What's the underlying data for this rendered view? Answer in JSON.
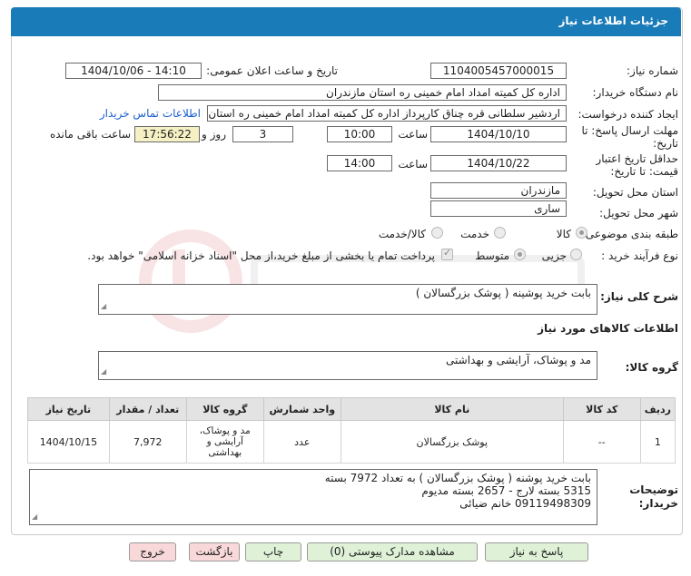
{
  "header": {
    "title": "جزئیات اطلاعات نیاز"
  },
  "fields": {
    "need_number_label": "شماره نیاز:",
    "need_number": "1104005457000015",
    "announce_label": "تاریخ و ساعت اعلان عمومی:",
    "announce_value": "1404/10/06 - 14:10",
    "buyer_org_label": "نام دستگاه خریدار:",
    "buyer_org": "اداره کل کمیته امداد امام خمینی  ره  استان مازندران",
    "requester_label": "ایجاد کننده درخواست:",
    "requester": "اردشیر سلطانی قره چناق کارپرداز اداره کل کمیته امداد امام خمینی  ره  استان",
    "contact_link": "اطلاعات تماس خریدار",
    "deadline_label_1": "مهلت ارسال پاسخ: تا",
    "deadline_label_2": "تاریخ:",
    "deadline_date": "1404/10/10",
    "time_label": "ساعت",
    "deadline_time": "10:00",
    "days_value": "3",
    "days_and_label": "روز و",
    "remaining_time": "17:56:22",
    "remaining_label": "ساعت باقی مانده",
    "validity_label_1": "حداقل تاریخ اعتبار",
    "validity_label_2": "قیمت: تا تاریخ:",
    "validity_date": "1404/10/22",
    "validity_time": "14:00",
    "province_label": "استان محل تحویل:",
    "province": "مازندران",
    "city_label": "شهر محل تحویل:",
    "city": "ساری",
    "category_label": "طبقه بندی موضوعی:",
    "category_options": [
      "کالا",
      "خدمت",
      "کالا/خدمت"
    ],
    "process_label": "نوع فرآیند خرید :",
    "process_options": [
      "جزیی",
      "متوسط"
    ],
    "payment_note": "پرداخت تمام یا بخشی از مبلغ خرید،از محل \"اسناد خزانه اسلامی\" خواهد بود."
  },
  "summary": {
    "label": "شرح کلی نیاز:",
    "text": "بابت خرید پوشینه ( پوشک بزرگسالان )"
  },
  "goods_info": {
    "title": "اطلاعات کالاهای مورد نیاز",
    "group_label": "گروه کالا:",
    "group_value": "مد و پوشاک، آرایشی و بهداشتی"
  },
  "table": {
    "headers": [
      "ردیف",
      "کد کالا",
      "نام کالا",
      "واحد شمارش",
      "گروه کالا",
      "تعداد / مقدار",
      "تاریخ نیاز"
    ],
    "rows": [
      [
        "1",
        "--",
        "پوشک بزرگسالان",
        "عدد",
        "مد و پوشاک، آرایشی و بهداشتی",
        "7,972",
        "1404/10/15"
      ]
    ]
  },
  "buyer_notes": {
    "label_1": "توضیحات",
    "label_2": "خریدار:",
    "lines": [
      "بابت خرید پوشنه ( پوشک بزرگسالان ) به تعداد 7972 بسته",
      "5315 بسته لارج - 2657 بسته مدیوم",
      "09119498309 خانم ضیائی"
    ]
  },
  "buttons": {
    "reply": "پاسخ به نیاز",
    "docs": "مشاهده مدارک پیوستی (0)",
    "print": "چاپ",
    "back": "بازگشت",
    "exit": "خروج"
  },
  "colors": {
    "header": "#1a7bb9",
    "button_green": "#dff2d8",
    "button_red": "#f8d8d8",
    "link": "#1a5fd0"
  }
}
